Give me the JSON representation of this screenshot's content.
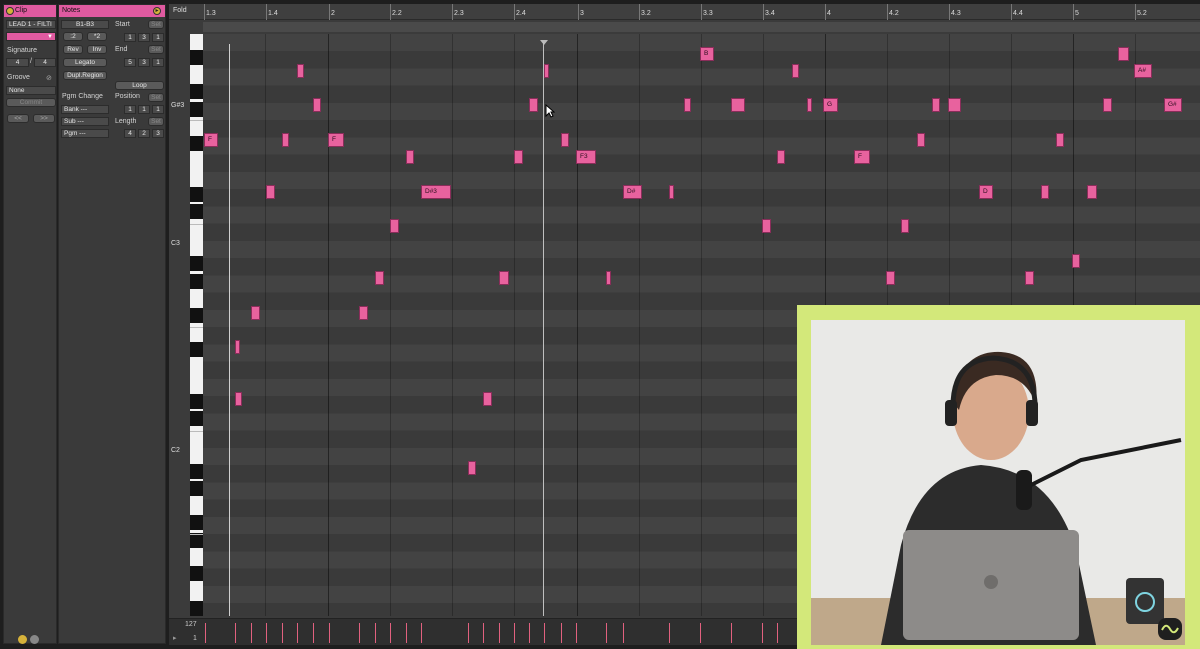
{
  "clip": {
    "header": "Clip",
    "name": "LEAD 1 - FILTI",
    "signature_label": "Signature",
    "sig_num": "4",
    "sig_slash": "/",
    "sig_den": "4",
    "groove_label": "Groove",
    "groove_value": "None",
    "commit_label": "Commit",
    "nav_prev": "<<",
    "nav_next": ">>"
  },
  "notes": {
    "header": "Notes",
    "range": "B1-B3",
    "div2": ":2",
    "mul2": "*2",
    "rev": "Rev",
    "inv": "Inv",
    "legato": "Legato",
    "dupl": "Dupl.Region",
    "pgm_change": "Pgm Change",
    "bank": "Bank ---",
    "sub": "Sub ---",
    "pgm": "Pgm ---",
    "start_label": "Start",
    "set": "Set",
    "start": [
      "1",
      "3",
      "1"
    ],
    "end_label": "End",
    "end": [
      "5",
      "3",
      "1"
    ],
    "loop": "Loop",
    "position_label": "Position",
    "position": [
      "1",
      "1",
      "1"
    ],
    "length_label": "Length",
    "length": [
      "4",
      "2",
      "3"
    ]
  },
  "editor": {
    "fold": "Fold",
    "ticks": [
      "1.3",
      "1.4",
      "2",
      "2.2",
      "2.3",
      "2.4",
      "3",
      "3.2",
      "3.3",
      "3.4",
      "4",
      "4.2",
      "4.3",
      "4.4",
      "5",
      "5.2"
    ],
    "key_labels": [
      "G#3",
      "C3",
      "C2"
    ],
    "velocity_max": "127",
    "velocity_min": "1"
  },
  "note_labels": {
    "n_b": "B",
    "n_asharp": "A#",
    "n_g": "G",
    "n_gsharp": "G#",
    "n_f1": "F",
    "n_f3": "F3",
    "n_f2": "F",
    "n_dsharp3": "D#3",
    "n_dsharp": "D#",
    "n_d": "D",
    "n_f_left": "F"
  }
}
